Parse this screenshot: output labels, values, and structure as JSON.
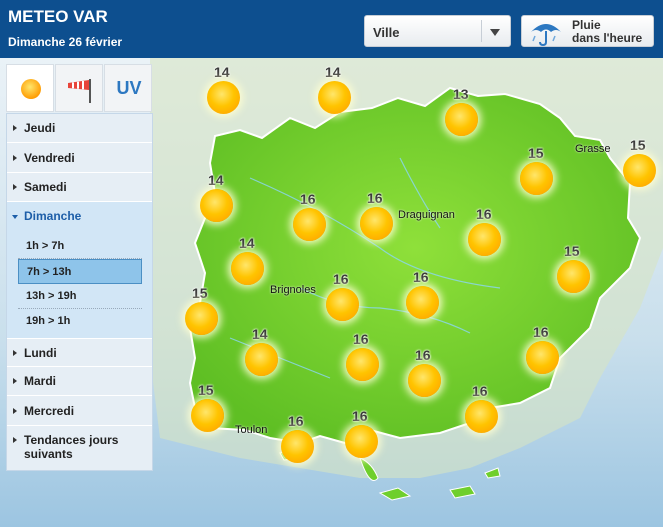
{
  "header": {
    "title": "METEO VAR",
    "date": "Dimanche 26 février",
    "ville_select": "Ville",
    "pluie_line1": "Pluie",
    "pluie_line2": "dans l'heure",
    "background_color": "#0d4f8f"
  },
  "tabs": [
    {
      "icon": "sun-icon",
      "active": true
    },
    {
      "icon": "windsock-icon",
      "active": false
    },
    {
      "label": "UV",
      "active": false
    }
  ],
  "menu": {
    "days": [
      {
        "label": "Jeudi"
      },
      {
        "label": "Vendredi"
      },
      {
        "label": "Samedi"
      },
      {
        "label": "Dimanche",
        "open": true
      },
      {
        "label": "Lundi"
      },
      {
        "label": "Mardi"
      },
      {
        "label": "Mercredi"
      },
      {
        "label": "Tendances jours suivants"
      }
    ],
    "slots": [
      {
        "label": "1h > 7h"
      },
      {
        "label": "7h > 13h",
        "active": true
      },
      {
        "label": "13h > 19h"
      },
      {
        "label": "19h > 1h"
      }
    ]
  },
  "cities": [
    "Grasse",
    "Draguignan",
    "Brignoles",
    "Toulon"
  ],
  "weather": [
    "14",
    "14",
    "13",
    "15",
    "15",
    "14",
    "16",
    "16",
    "16",
    "14",
    "16",
    "16",
    "15",
    "15",
    "14",
    "16",
    "16",
    "16",
    "15",
    "16",
    "16",
    "16"
  ],
  "colors": {
    "land": "#6fcf2c",
    "sea": "#9cc5e1",
    "sun": "#ffc400",
    "accent": "#1d5ea8"
  }
}
